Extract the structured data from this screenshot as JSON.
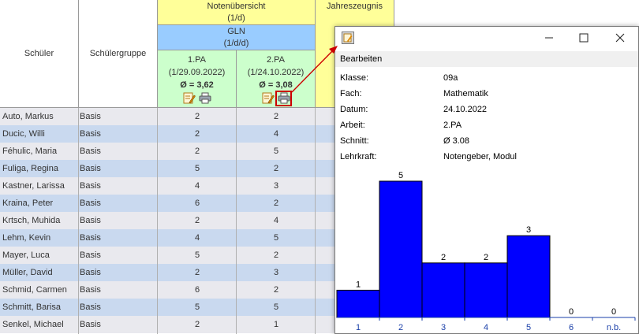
{
  "table": {
    "col_student": "Schüler",
    "col_group": "Schülergruppe",
    "overview_title": "Notenübersicht",
    "overview_sub": "(1/d)",
    "year_title": "Jahreszeugnis",
    "gln_title": "GLN",
    "gln_sub": "(1/d/d)",
    "tests": [
      {
        "name": "1.PA",
        "date": "(1/29.09.2022)",
        "avg": "Ø = 3,62"
      },
      {
        "name": "2.PA",
        "date": "(1/24.10.2022)",
        "avg": "Ø = 3,08"
      }
    ],
    "rows": [
      {
        "name": "Auto, Markus",
        "group": "Basis",
        "g1": "2",
        "g2": "2"
      },
      {
        "name": "Ducic, Willi",
        "group": "Basis",
        "g1": "2",
        "g2": "4"
      },
      {
        "name": "Féhulic, Maria",
        "group": "Basis",
        "g1": "2",
        "g2": "5"
      },
      {
        "name": "Fuliga, Regina",
        "group": "Basis",
        "g1": "5",
        "g2": "2"
      },
      {
        "name": "Kastner, Larissa",
        "group": "Basis",
        "g1": "4",
        "g2": "3"
      },
      {
        "name": "Kraina, Peter",
        "group": "Basis",
        "g1": "6",
        "g2": "2"
      },
      {
        "name": "Krtsch, Muhida",
        "group": "Basis",
        "g1": "2",
        "g2": "4"
      },
      {
        "name": "Lehm, Kevin",
        "group": "Basis",
        "g1": "4",
        "g2": "5"
      },
      {
        "name": "Mayer, Luca",
        "group": "Basis",
        "g1": "5",
        "g2": "2"
      },
      {
        "name": "Müller, David",
        "group": "Basis",
        "g1": "2",
        "g2": "3"
      },
      {
        "name": "Schmid, Carmen",
        "group": "Basis",
        "g1": "6",
        "g2": "2"
      },
      {
        "name": "Schmitt, Barisa",
        "group": "Basis",
        "g1": "5",
        "g2": "5"
      },
      {
        "name": "Senkel, Michael",
        "group": "Basis",
        "g1": "2",
        "g2": "1"
      }
    ]
  },
  "popup": {
    "menu_edit": "Bearbeiten",
    "details": [
      {
        "key": "Klasse:",
        "value": "09a"
      },
      {
        "key": "Fach:",
        "value": "Mathematik"
      },
      {
        "key": "Datum:",
        "value": "24.10.2022"
      },
      {
        "key": "Arbeit:",
        "value": "2.PA"
      },
      {
        "key": "Schnitt:",
        "value": "Ø 3.08"
      },
      {
        "key": "Lehrkraft:",
        "value": "Notengeber, Modul"
      }
    ]
  },
  "chart_data": {
    "type": "bar",
    "categories": [
      "1",
      "2",
      "3",
      "4",
      "5",
      "6",
      "n.b."
    ],
    "values": [
      1,
      5,
      2,
      2,
      3,
      0,
      0
    ],
    "ylim": [
      0,
      5
    ],
    "grid": false,
    "bar_color": "#0000ff"
  },
  "colors": {
    "header_yellow": "#ffff99",
    "header_blue": "#99ccff",
    "header_green": "#ccffcc",
    "row_odd": "#e9e9ee",
    "row_even": "#c9d9ef",
    "highlight_red": "#cc0000"
  }
}
